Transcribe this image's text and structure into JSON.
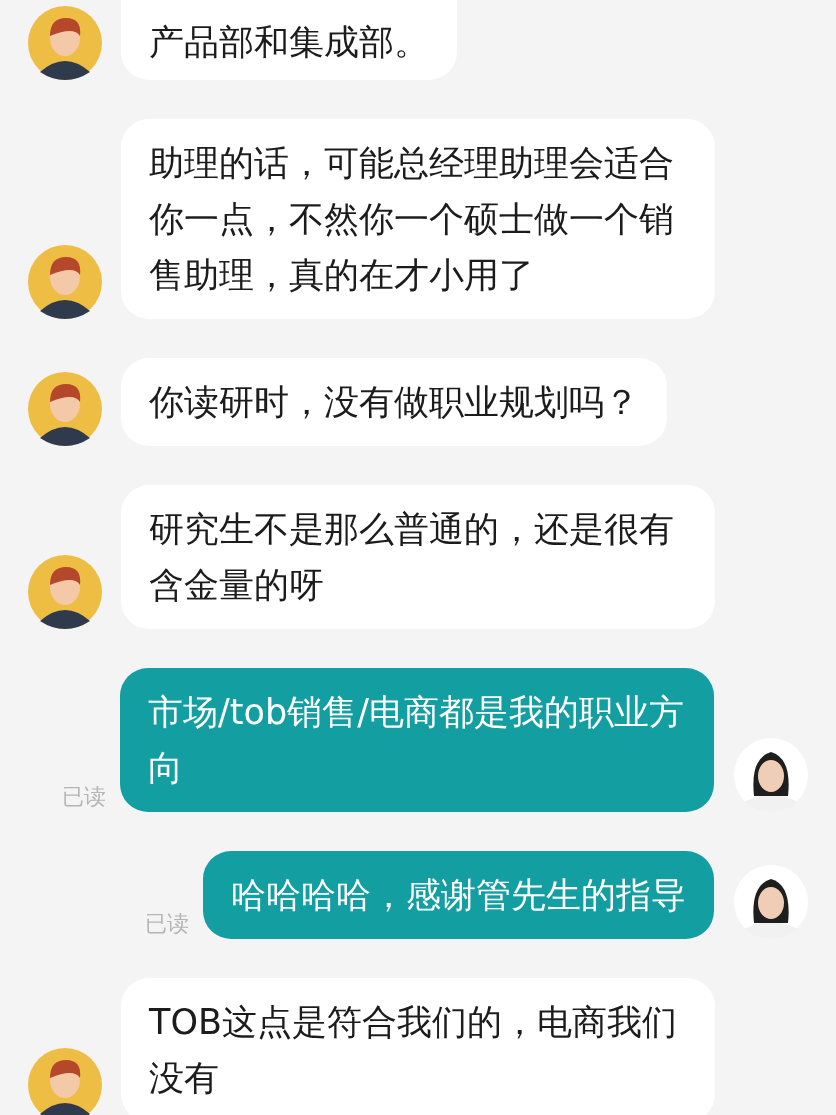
{
  "messages": [
    {
      "kind": "incoming",
      "text": "产品部和集成部。"
    },
    {
      "kind": "incoming",
      "text": "助理的话，可能总经理助理会适合你一点，不然你一个硕士做一个销售助理，真的在才小用了"
    },
    {
      "kind": "incoming",
      "text": "你读研时，没有做职业规划吗？"
    },
    {
      "kind": "incoming",
      "text": "研究生不是那么普通的，还是很有含金量的呀"
    },
    {
      "kind": "outgoing",
      "text": "市场/tob销售/电商都是我的职业方向",
      "status": "已读"
    },
    {
      "kind": "outgoing",
      "text": "哈哈哈哈，感谢管先生的指导",
      "status": "已读"
    },
    {
      "kind": "incoming",
      "text": "TOB这点是符合我们的，电商我们没有"
    }
  ]
}
